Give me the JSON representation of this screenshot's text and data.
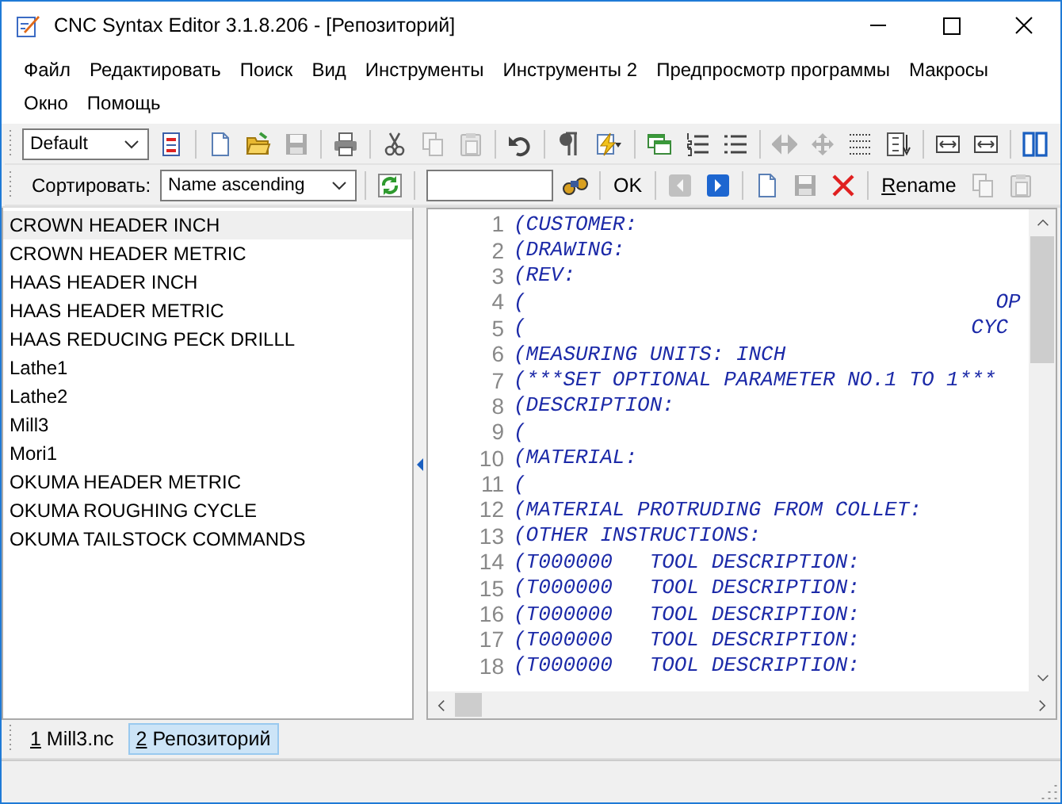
{
  "window": {
    "title": "CNC Syntax Editor 3.1.8.206 - [Репозиторий]"
  },
  "menu": [
    "Файл",
    "Редактировать",
    "Поиск",
    "Вид",
    "Инструменты",
    "Инструменты 2",
    "Предпросмотр программы",
    "Макросы",
    "Окно",
    "Помощь"
  ],
  "toolbar": [
    {
      "kind": "combo",
      "value": "Default"
    },
    {
      "kind": "properties",
      "disabled": false
    },
    {
      "kind": "sep"
    },
    {
      "kind": "new",
      "disabled": false
    },
    {
      "kind": "open",
      "disabled": false
    },
    {
      "kind": "save",
      "disabled": true
    },
    {
      "kind": "sep"
    },
    {
      "kind": "print",
      "disabled": false
    },
    {
      "kind": "sep"
    },
    {
      "kind": "cut",
      "disabled": false
    },
    {
      "kind": "copy",
      "disabled": true
    },
    {
      "kind": "paste",
      "disabled": true
    },
    {
      "kind": "sep"
    },
    {
      "kind": "undo",
      "disabled": false
    },
    {
      "kind": "sep"
    },
    {
      "kind": "pilcrow",
      "disabled": false
    },
    {
      "kind": "wand",
      "disabled": false
    },
    {
      "kind": "sep"
    },
    {
      "kind": "windows",
      "disabled": false
    },
    {
      "kind": "numlist",
      "disabled": false
    },
    {
      "kind": "bullist",
      "disabled": false
    },
    {
      "kind": "sep"
    },
    {
      "kind": "harrows",
      "disabled": true
    },
    {
      "kind": "move",
      "disabled": true
    },
    {
      "kind": "grid",
      "disabled": false
    },
    {
      "kind": "sort",
      "disabled": false
    },
    {
      "kind": "sep"
    },
    {
      "kind": "bar",
      "disabled": false
    },
    {
      "kind": "bar",
      "disabled": false
    },
    {
      "kind": "sep"
    },
    {
      "kind": "columns",
      "disabled": false
    }
  ],
  "repository_bar": [
    {
      "kind": "label",
      "text": "Сортировать:"
    },
    {
      "kind": "combo",
      "value": "Name ascending"
    },
    {
      "kind": "sep"
    },
    {
      "kind": "refresh",
      "disabled": false
    },
    {
      "kind": "sep"
    },
    {
      "kind": "field"
    },
    {
      "kind": "binoculars",
      "disabled": false
    },
    {
      "kind": "sep"
    },
    {
      "kind": "ok",
      "text": "OK"
    },
    {
      "kind": "sep"
    },
    {
      "kind": "prev",
      "disabled": true
    },
    {
      "kind": "next",
      "disabled": false
    },
    {
      "kind": "sep"
    },
    {
      "kind": "new",
      "disabled": false
    },
    {
      "kind": "save",
      "disabled": true
    },
    {
      "kind": "delete",
      "disabled": false
    },
    {
      "kind": "sep"
    },
    {
      "kind": "textbutton",
      "key": "R",
      "text": "ename"
    },
    {
      "kind": "copy",
      "disabled": true
    },
    {
      "kind": "paste",
      "disabled": true
    }
  ],
  "repository": [
    {
      "name": "CROWN HEADER INCH",
      "selected": true
    },
    {
      "name": "CROWN HEADER METRIC",
      "selected": false
    },
    {
      "name": "HAAS HEADER INCH",
      "selected": false
    },
    {
      "name": "HAAS HEADER METRIC",
      "selected": false
    },
    {
      "name": "HAAS REDUCING PECK DRILLL",
      "selected": false
    },
    {
      "name": "Lathe1",
      "selected": false
    },
    {
      "name": "Lathe2",
      "selected": false
    },
    {
      "name": "Mill3",
      "selected": false
    },
    {
      "name": "Mori1",
      "selected": false
    },
    {
      "name": "OKUMA HEADER METRIC",
      "selected": false
    },
    {
      "name": "OKUMA ROUGHING CYCLE",
      "selected": false
    },
    {
      "name": "OKUMA TAILSTOCK COMMANDS",
      "selected": false
    }
  ],
  "editor": {
    "lines": [
      {
        "number": "1",
        "text": "(CUSTOMER:"
      },
      {
        "number": "2",
        "text": "(DRAWING:"
      },
      {
        "number": "3",
        "text": "(REV:"
      },
      {
        "number": "4",
        "text": "(                                      OP"
      },
      {
        "number": "5",
        "text": "(                                    CYC"
      },
      {
        "number": "6",
        "text": "(MEASURING UNITS: INCH"
      },
      {
        "number": "7",
        "text": "(***SET OPTIONAL PARAMETER NO.1 TO 1***"
      },
      {
        "number": "8",
        "text": "(DESCRIPTION:"
      },
      {
        "number": "9",
        "text": "("
      },
      {
        "number": "10",
        "text": "(MATERIAL:"
      },
      {
        "number": "11",
        "text": "("
      },
      {
        "number": "12",
        "text": "(MATERIAL PROTRUDING FROM COLLET:"
      },
      {
        "number": "13",
        "text": "(OTHER INSTRUCTIONS:"
      },
      {
        "number": "14",
        "text": "(T000000   TOOL DESCRIPTION:"
      },
      {
        "number": "15",
        "text": "(T000000   TOOL DESCRIPTION:"
      },
      {
        "number": "16",
        "text": "(T000000   TOOL DESCRIPTION:"
      },
      {
        "number": "17",
        "text": "(T000000   TOOL DESCRIPTION:"
      },
      {
        "number": "18",
        "text": "(T000000   TOOL DESCRIPTION:"
      }
    ]
  },
  "tabs": [
    {
      "key": "1",
      "label": "Mill3.nc",
      "selected": false
    },
    {
      "key": "2",
      "label": "Репозиторий",
      "selected": true
    }
  ]
}
